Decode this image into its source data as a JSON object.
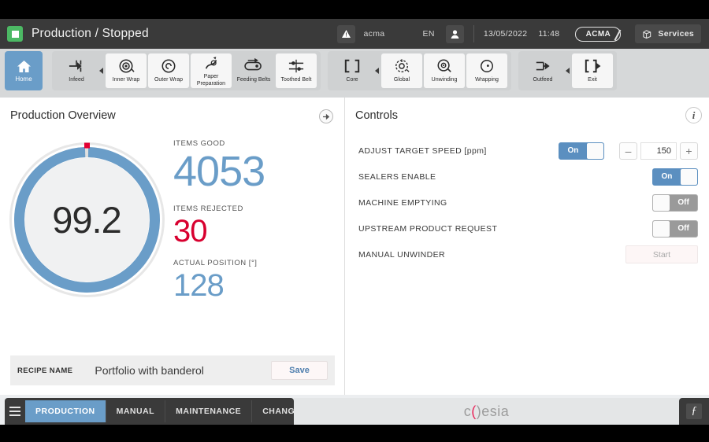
{
  "topbar": {
    "status_icon": "stop-square-icon",
    "status_color": "#4cb964",
    "title": "Production / Stopped",
    "alarm_icon": "warning-triangle-icon",
    "user_name": "acma",
    "language": "EN",
    "user_icon": "user-icon",
    "date": "13/05/2022",
    "time": "11:48",
    "brand_badge": "ACMA",
    "services_icon": "cube-icon",
    "services_label": "Services"
  },
  "navbar": {
    "home": {
      "label": "Home",
      "icon": "home-icon"
    },
    "groups": [
      {
        "items": [
          {
            "label": "Infeed",
            "icon": "infeed-icon",
            "style": "plain"
          },
          {
            "separator": "triangle-left-icon"
          },
          {
            "label": "Inner Wrap",
            "icon": "inner-wrap-icon",
            "style": "card"
          },
          {
            "label": "Outer Wrap",
            "icon": "outer-wrap-icon",
            "style": "card"
          },
          {
            "label": "Paper Preparation",
            "icon": "paper-preparation-icon",
            "style": "card"
          },
          {
            "label": "Feeding Belts",
            "icon": "feeding-belts-icon",
            "style": "plain"
          },
          {
            "label": "Toothed Belt",
            "icon": "toothed-belt-icon",
            "style": "card"
          }
        ]
      },
      {
        "items": [
          {
            "label": "Core",
            "icon": "core-icon",
            "style": "plain"
          },
          {
            "separator": "triangle-left-icon"
          },
          {
            "label": "Global",
            "icon": "global-icon",
            "style": "card"
          },
          {
            "label": "Unwinding",
            "icon": "unwinding-icon",
            "style": "card"
          },
          {
            "label": "Wrapping",
            "icon": "wrapping-icon",
            "style": "card"
          }
        ]
      },
      {
        "items": [
          {
            "label": "Outfeed",
            "icon": "outfeed-icon",
            "style": "plain"
          },
          {
            "separator": "triangle-left-icon"
          },
          {
            "label": "Exit",
            "icon": "exit-icon",
            "style": "card"
          }
        ]
      }
    ]
  },
  "overview": {
    "title": "Production Overview",
    "expand_icon": "arrow-right-circle-icon",
    "gauge": {
      "value": "99.2",
      "percent": 99.2,
      "ring_color": "#6a9dc8",
      "marker_color": "#e30033"
    },
    "kpis": [
      {
        "label": "ITEMS GOOD",
        "value": "4053",
        "color": "#6a9dc8"
      },
      {
        "label": "ITEMS REJECTED",
        "value": "30",
        "color": "#d8002f"
      },
      {
        "label": "ACTUAL POSITION [°]",
        "value": "128",
        "color": "#6a9dc8"
      }
    ],
    "recipe": {
      "label": "RECIPE NAME",
      "value": "Portfolio with banderol",
      "save_label": "Save"
    }
  },
  "controls": {
    "title": "Controls",
    "info_icon": "info-icon",
    "rows": [
      {
        "label": "ADJUST TARGET SPEED [ppm]",
        "toggle": "On",
        "toggle_state": "on",
        "stepper": {
          "minus": "–",
          "value": "150",
          "plus": "+"
        }
      },
      {
        "label": "SEALERS ENABLE",
        "toggle": "On",
        "toggle_state": "on"
      },
      {
        "label": "MACHINE EMPTYING",
        "toggle": "Off",
        "toggle_state": "off"
      },
      {
        "label": "UPSTREAM PRODUCT REQUEST",
        "toggle": "Off",
        "toggle_state": "off"
      },
      {
        "label": "MANUAL UNWINDER",
        "button": "Start"
      }
    ]
  },
  "bottombar": {
    "menu_icon": "hamburger-menu-icon",
    "tabs": [
      {
        "label": "PRODUCTION",
        "active": true
      },
      {
        "label": "MANUAL",
        "active": false
      },
      {
        "label": "MAINTENANCE",
        "active": false
      },
      {
        "label": "CHANGEOVER",
        "active": false
      }
    ],
    "logo_text_before": "c",
    "logo_mark": "(",
    "logo_text_after": ")esia",
    "logo_full": "coesia",
    "function_button": "ƒ"
  }
}
